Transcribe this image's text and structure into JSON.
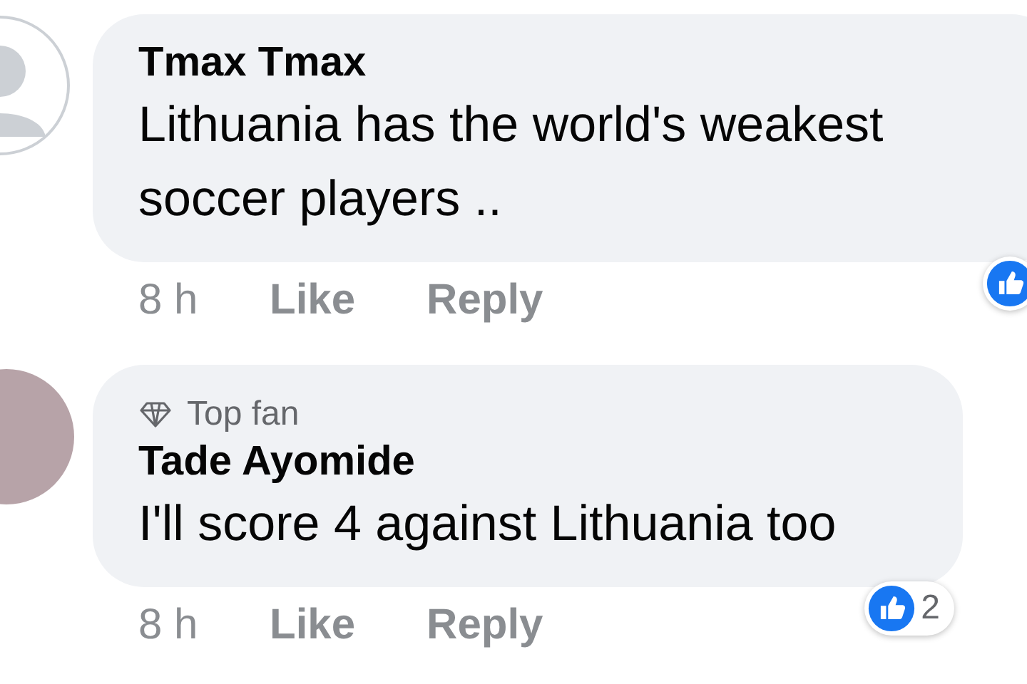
{
  "comments": [
    {
      "kind": "silhouette",
      "author": "Tmax Tmax",
      "text": "Lithuania has the world's weakest soccer players ..",
      "time": "8 h",
      "actions": [
        "Like",
        "Reply"
      ]
    },
    {
      "kind": "photo",
      "badge": "Top fan",
      "author": "Tade Ayomide",
      "text": "I'll score 4 against Lithuania too",
      "time": "8 h",
      "actions": [
        "Like",
        "Reply"
      ],
      "reaction_count": "2"
    }
  ]
}
